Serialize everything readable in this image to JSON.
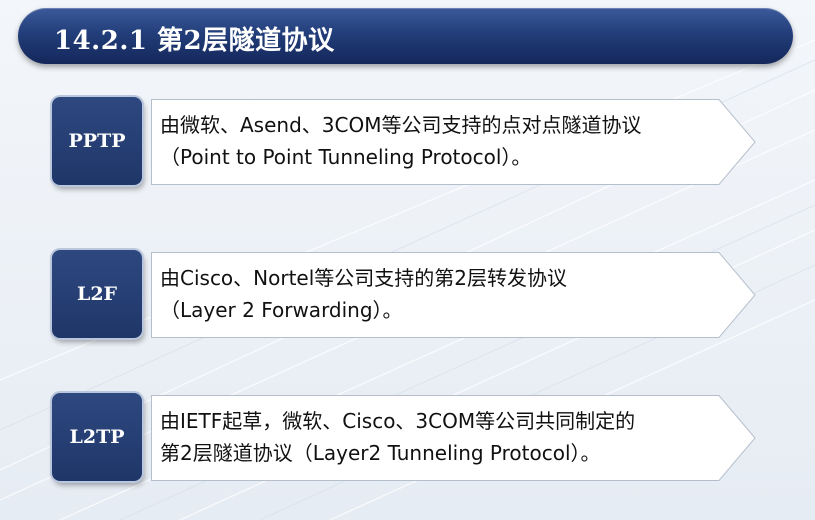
{
  "slide": {
    "title": "14.2.1 第2层隧道协议"
  },
  "protocols": [
    {
      "tag": "PPTP",
      "line1": "由微软、Asend、3COM等公司支持的点对点隧道协议",
      "line2": "（Point to Point Tunneling Protocol）。"
    },
    {
      "tag": "L2F",
      "line1": "由Cisco、Nortel等公司支持的第2层转发协议",
      "line2": "（Layer 2 Forwarding）。"
    },
    {
      "tag": "L2TP",
      "line1": "由IETF起草，微软、Cisco、3COM等公司共同制定的",
      "line2": "第2层隧道协议（Layer2 Tunneling Protocol）。"
    }
  ],
  "colors": {
    "title_bar": "#223e7a",
    "tag_fill": "#1f3668",
    "box_border": "#b5bfcc",
    "text": "#111111"
  }
}
